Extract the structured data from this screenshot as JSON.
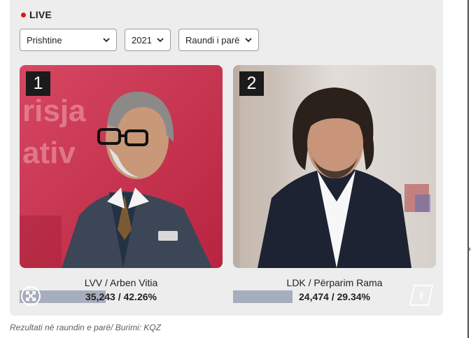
{
  "live": {
    "label": "LIVE",
    "dot_color": "#e3131b"
  },
  "filters": {
    "municipality": "Prishtine",
    "year": "2021",
    "round": "Raundi i parë"
  },
  "candidates": [
    {
      "rank": "1",
      "name": "LVV / Arben Vitia",
      "result": "35,243 / 42.26%",
      "percent": 42.26
    },
    {
      "rank": "2",
      "name": "LDK / Përparim Rama",
      "result": "24,474 / 29.34%",
      "percent": 29.34
    }
  ],
  "caption": "Rezultati në raundin e parë/ Burimi: KQZ",
  "icons": {
    "expand": "expand-arrows-icon",
    "share": "facebook-icon"
  },
  "colors": {
    "bar": "#a6adbc",
    "card1_bg": "#c8344f",
    "card2_bg": "#cfc7c0"
  }
}
